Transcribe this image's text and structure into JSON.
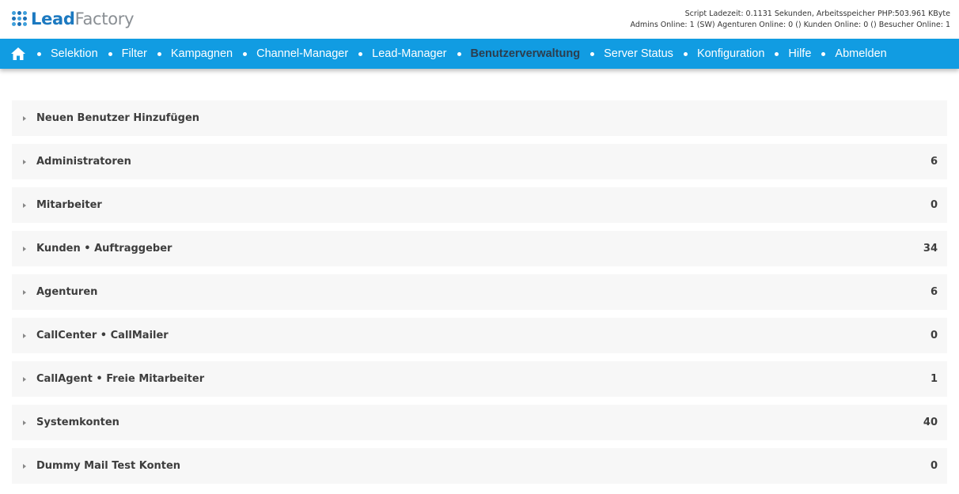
{
  "brand": {
    "logo_bold": "Lead",
    "logo_light": "Factory",
    "colors": {
      "primary": "#1c79c0",
      "secondary": "#8a8f94"
    }
  },
  "stats": {
    "line1": "Script Ladezeit: 0.1131 Sekunden, Arbeitsspeicher PHP:503.961 KByte",
    "line2": "Admins Online: 1 (SW) Agenturen Online: 0 () Kunden Online: 0 () Besucher Online: 1"
  },
  "nav": {
    "home_icon": "home-icon",
    "bar_color": "#119ce2",
    "items": [
      {
        "label": "Selektion",
        "active": false
      },
      {
        "label": "Filter",
        "active": false
      },
      {
        "label": "Kampagnen",
        "active": false
      },
      {
        "label": "Channel-Manager",
        "active": false
      },
      {
        "label": "Lead-Manager",
        "active": false
      },
      {
        "label": "Benutzerverwaltung",
        "active": true
      },
      {
        "label": "Server Status",
        "active": false
      },
      {
        "label": "Konfiguration",
        "active": false
      },
      {
        "label": "Hilfe",
        "active": false
      },
      {
        "label": "Abmelden",
        "active": false
      }
    ]
  },
  "sections": [
    {
      "label": "Neuen Benutzer Hinzufügen",
      "count": ""
    },
    {
      "label": "Administratoren",
      "count": "6"
    },
    {
      "label": "Mitarbeiter",
      "count": "0"
    },
    {
      "label": "Kunden • Auftraggeber",
      "count": "34"
    },
    {
      "label": "Agenturen",
      "count": "6"
    },
    {
      "label": "CallCenter • CallMailer",
      "count": "0"
    },
    {
      "label": "CallAgent • Freie Mitarbeiter",
      "count": "1"
    },
    {
      "label": "Systemkonten",
      "count": "40"
    },
    {
      "label": "Dummy Mail Test Konten",
      "count": "0"
    }
  ]
}
